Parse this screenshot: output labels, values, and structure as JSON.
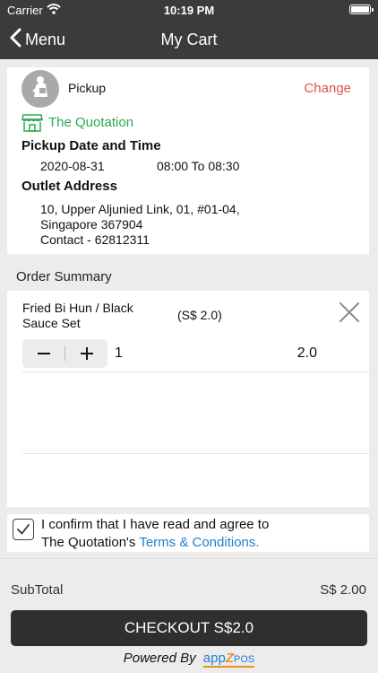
{
  "status_bar": {
    "carrier": "Carrier",
    "time": "10:19 PM"
  },
  "nav": {
    "back_label": "Menu",
    "title": "My Cart"
  },
  "pickup": {
    "label": "Pickup",
    "change_label": "Change",
    "outlet_name": "The Quotation",
    "date_time_heading": "Pickup Date and Time",
    "date": "2020-08-31",
    "time": "08:00 To 08:30",
    "address_heading": "Outlet Address",
    "address_line1": "10, Upper Aljunied Link, 01, #01-04,",
    "address_line2": "Singapore 367904",
    "contact": "Contact - 62812311"
  },
  "order": {
    "title": "Order Summary",
    "items": [
      {
        "name": "Fried Bi Hun / Black Sauce Set",
        "unit_price": "(S$ 2.0)",
        "quantity": "1",
        "total": "2.0"
      }
    ]
  },
  "confirm": {
    "checked": true,
    "text_line1": "I confirm that I have read and agree to",
    "text_prefix": "The Quotation's ",
    "terms_label": "Terms & Conditions."
  },
  "footer": {
    "subtotal_label": "SubTotal",
    "subtotal_value": "S$ 2.00",
    "checkout_label": "CHECKOUT S$2.0",
    "powered_by": "Powered By",
    "brand_prefix": "app",
    "brand_z": "Z",
    "brand_suffix": "POS"
  },
  "colors": {
    "accent_red": "#e0524d",
    "accent_green": "#2aaa50",
    "link_blue": "#1f7ed0",
    "header_bg": "#3b3b3b",
    "button_bg": "#2f2f2f"
  }
}
